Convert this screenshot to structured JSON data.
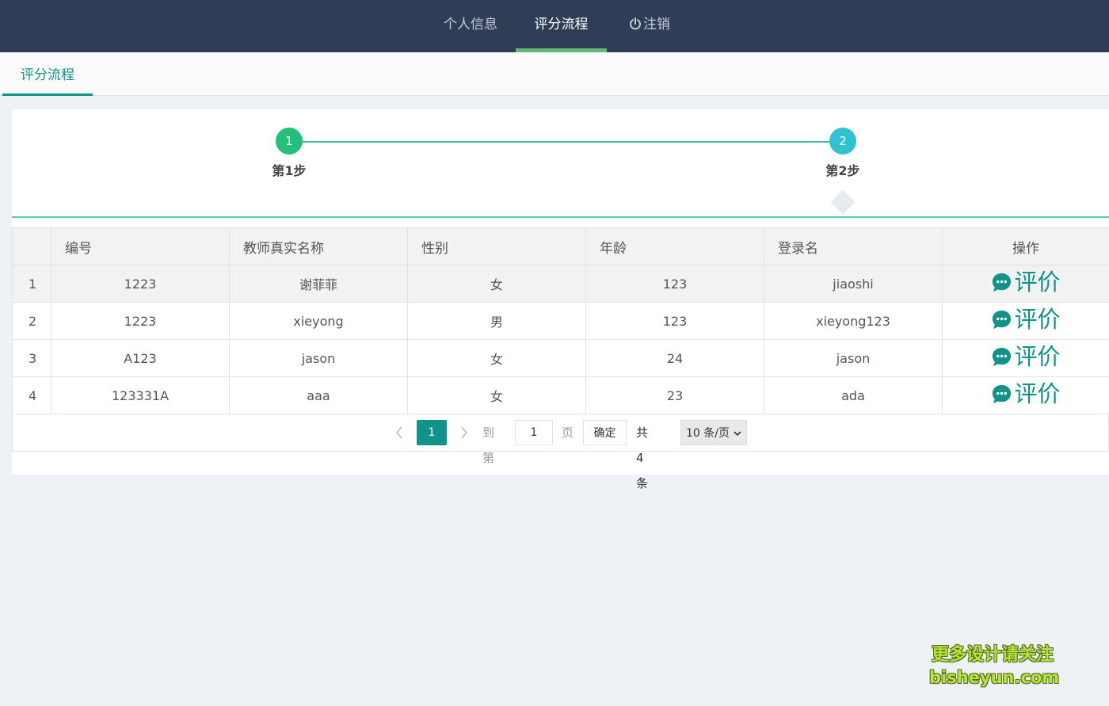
{
  "nav": {
    "items": [
      {
        "label": "个人信息"
      },
      {
        "label": "评分流程",
        "active": true
      },
      {
        "label": "注销",
        "icon": "power-icon"
      }
    ]
  },
  "tabs": [
    {
      "label": "评分流程",
      "active": true
    }
  ],
  "steps": [
    {
      "number": "1",
      "label": "第1步",
      "color": "#22c07a"
    },
    {
      "number": "2",
      "label": "第2步",
      "color": "#30c3cf"
    }
  ],
  "table": {
    "columns": [
      "",
      "编号",
      "教师真实名称",
      "性别",
      "年龄",
      "登录名",
      "操作"
    ],
    "rows": [
      {
        "idx": "1",
        "id": "1223",
        "name": "谢菲菲",
        "gender": "女",
        "age": "123",
        "login": "jiaoshi",
        "action": "评价"
      },
      {
        "idx": "2",
        "id": "1223",
        "name": "xieyong",
        "gender": "男",
        "age": "123",
        "login": "xieyong123",
        "action": "评价"
      },
      {
        "idx": "3",
        "id": "A123",
        "name": "jason",
        "gender": "女",
        "age": "24",
        "login": "jason",
        "action": "评价"
      },
      {
        "idx": "4",
        "id": "123331A",
        "name": "aaa",
        "gender": "女",
        "age": "23",
        "login": "ada",
        "action": "评价"
      }
    ]
  },
  "pagination": {
    "current_page": "1",
    "goto_label": "到第",
    "goto_value": "1",
    "page_label": "页",
    "confirm_label": "确定",
    "total_label": "共 4 条",
    "page_size_label": "10 条/页"
  },
  "watermark": {
    "line1": "更多设计请关注",
    "line2": "bisheyun.com"
  },
  "colors": {
    "nav_bg": "#2f3e56",
    "accent": "#10938a",
    "nav_active_bar": "#5fb878"
  }
}
